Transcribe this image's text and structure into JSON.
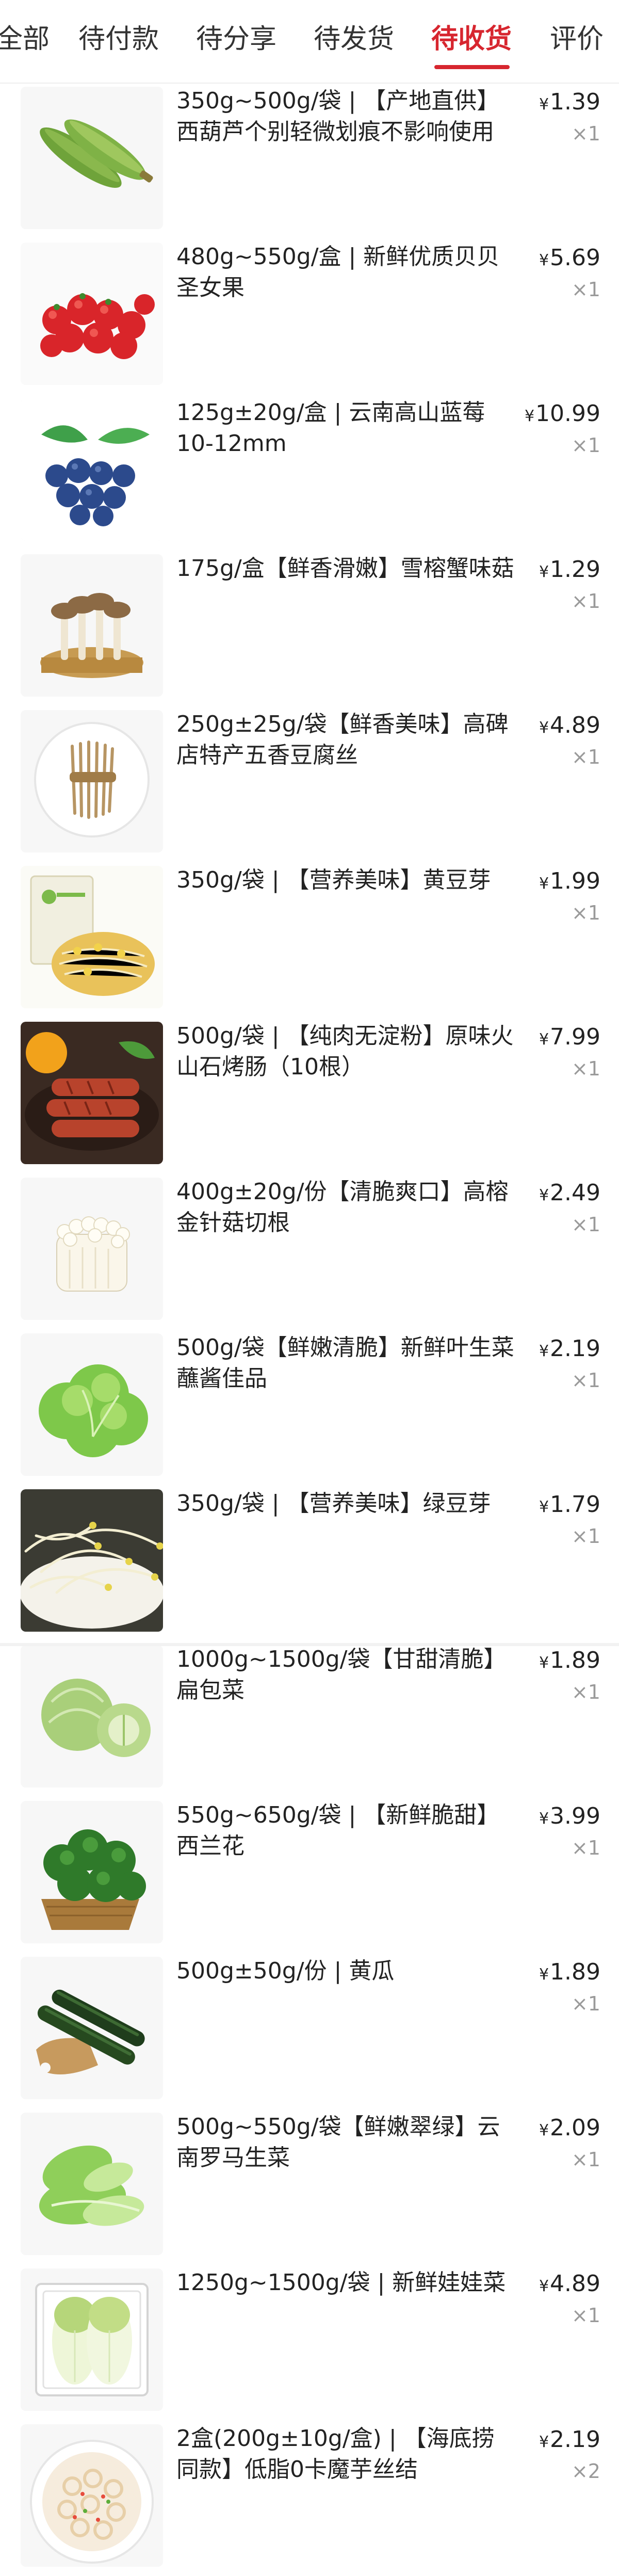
{
  "tabs": [
    {
      "label": "全部"
    },
    {
      "label": "待付款"
    },
    {
      "label": "待分享"
    },
    {
      "label": "待发货"
    },
    {
      "label": "待收货"
    },
    {
      "label": "评价"
    }
  ],
  "active_tab": "待收货",
  "currency": "¥",
  "items": [
    {
      "title": "350g~500g/袋 | 【产地直供】西葫芦个别轻微划痕不影响使用",
      "price": "1.39",
      "qty": "×1",
      "image": "zucchini"
    },
    {
      "title": "480g~550g/盒 | 新鲜优质贝贝圣女果",
      "price": "5.69",
      "qty": "×1",
      "image": "cherry-tomatoes"
    },
    {
      "title": "125g±20g/盒 | 云南高山蓝莓10-12mm",
      "price": "10.99",
      "qty": "×1",
      "image": "blueberries"
    },
    {
      "title": "175g/盒【鲜香滑嫩】雪榕蟹味菇",
      "price": "1.29",
      "qty": "×1",
      "image": "mushrooms"
    },
    {
      "title": "250g±25g/袋【鲜香美味】高碑店特产五香豆腐丝",
      "price": "4.89",
      "qty": "×1",
      "image": "tofu-strips"
    },
    {
      "title": "350g/袋 | 【营养美味】黄豆芽",
      "price": "1.99",
      "qty": "×1",
      "image": "soybean-sprouts"
    },
    {
      "title": "500g/袋 | 【纯肉无淀粉】原味火山石烤肠（10根）",
      "price": "7.99",
      "qty": "×1",
      "image": "sausages"
    },
    {
      "title": "400g±20g/份【清脆爽口】高榕金针菇切根",
      "price": "2.49",
      "qty": "×1",
      "image": "enoki"
    },
    {
      "title": "500g/袋【鲜嫩清脆】新鲜叶生菜蘸酱佳品",
      "price": "2.19",
      "qty": "×1",
      "image": "lettuce"
    },
    {
      "title": "350g/袋 | 【营养美味】绿豆芽",
      "price": "1.79",
      "qty": "×1",
      "image": "mung-sprouts"
    },
    {
      "title": "1000g~1500g/袋【甘甜清脆】扁包菜",
      "price": "1.89",
      "qty": "×1",
      "image": "cabbage"
    },
    {
      "title": "550g~650g/袋 | 【新鲜脆甜】西兰花",
      "price": "3.99",
      "qty": "×1",
      "image": "broccoli"
    },
    {
      "title": "500g±50g/份 | 黄瓜",
      "price": "1.89",
      "qty": "×1",
      "image": "cucumber"
    },
    {
      "title": "500g~550g/袋【鲜嫩翠绿】云南罗马生菜",
      "price": "2.09",
      "qty": "×1",
      "image": "romaine"
    },
    {
      "title": "1250g~1500g/袋 | 新鲜娃娃菜",
      "price": "4.89",
      "qty": "×1",
      "image": "baby-cabbage"
    },
    {
      "title": "2盒(200g±10g/盒) | 【海底捞同款】低脂0卡魔芋丝结",
      "price": "2.19",
      "qty": "×2",
      "image": "konjac-knots"
    }
  ]
}
